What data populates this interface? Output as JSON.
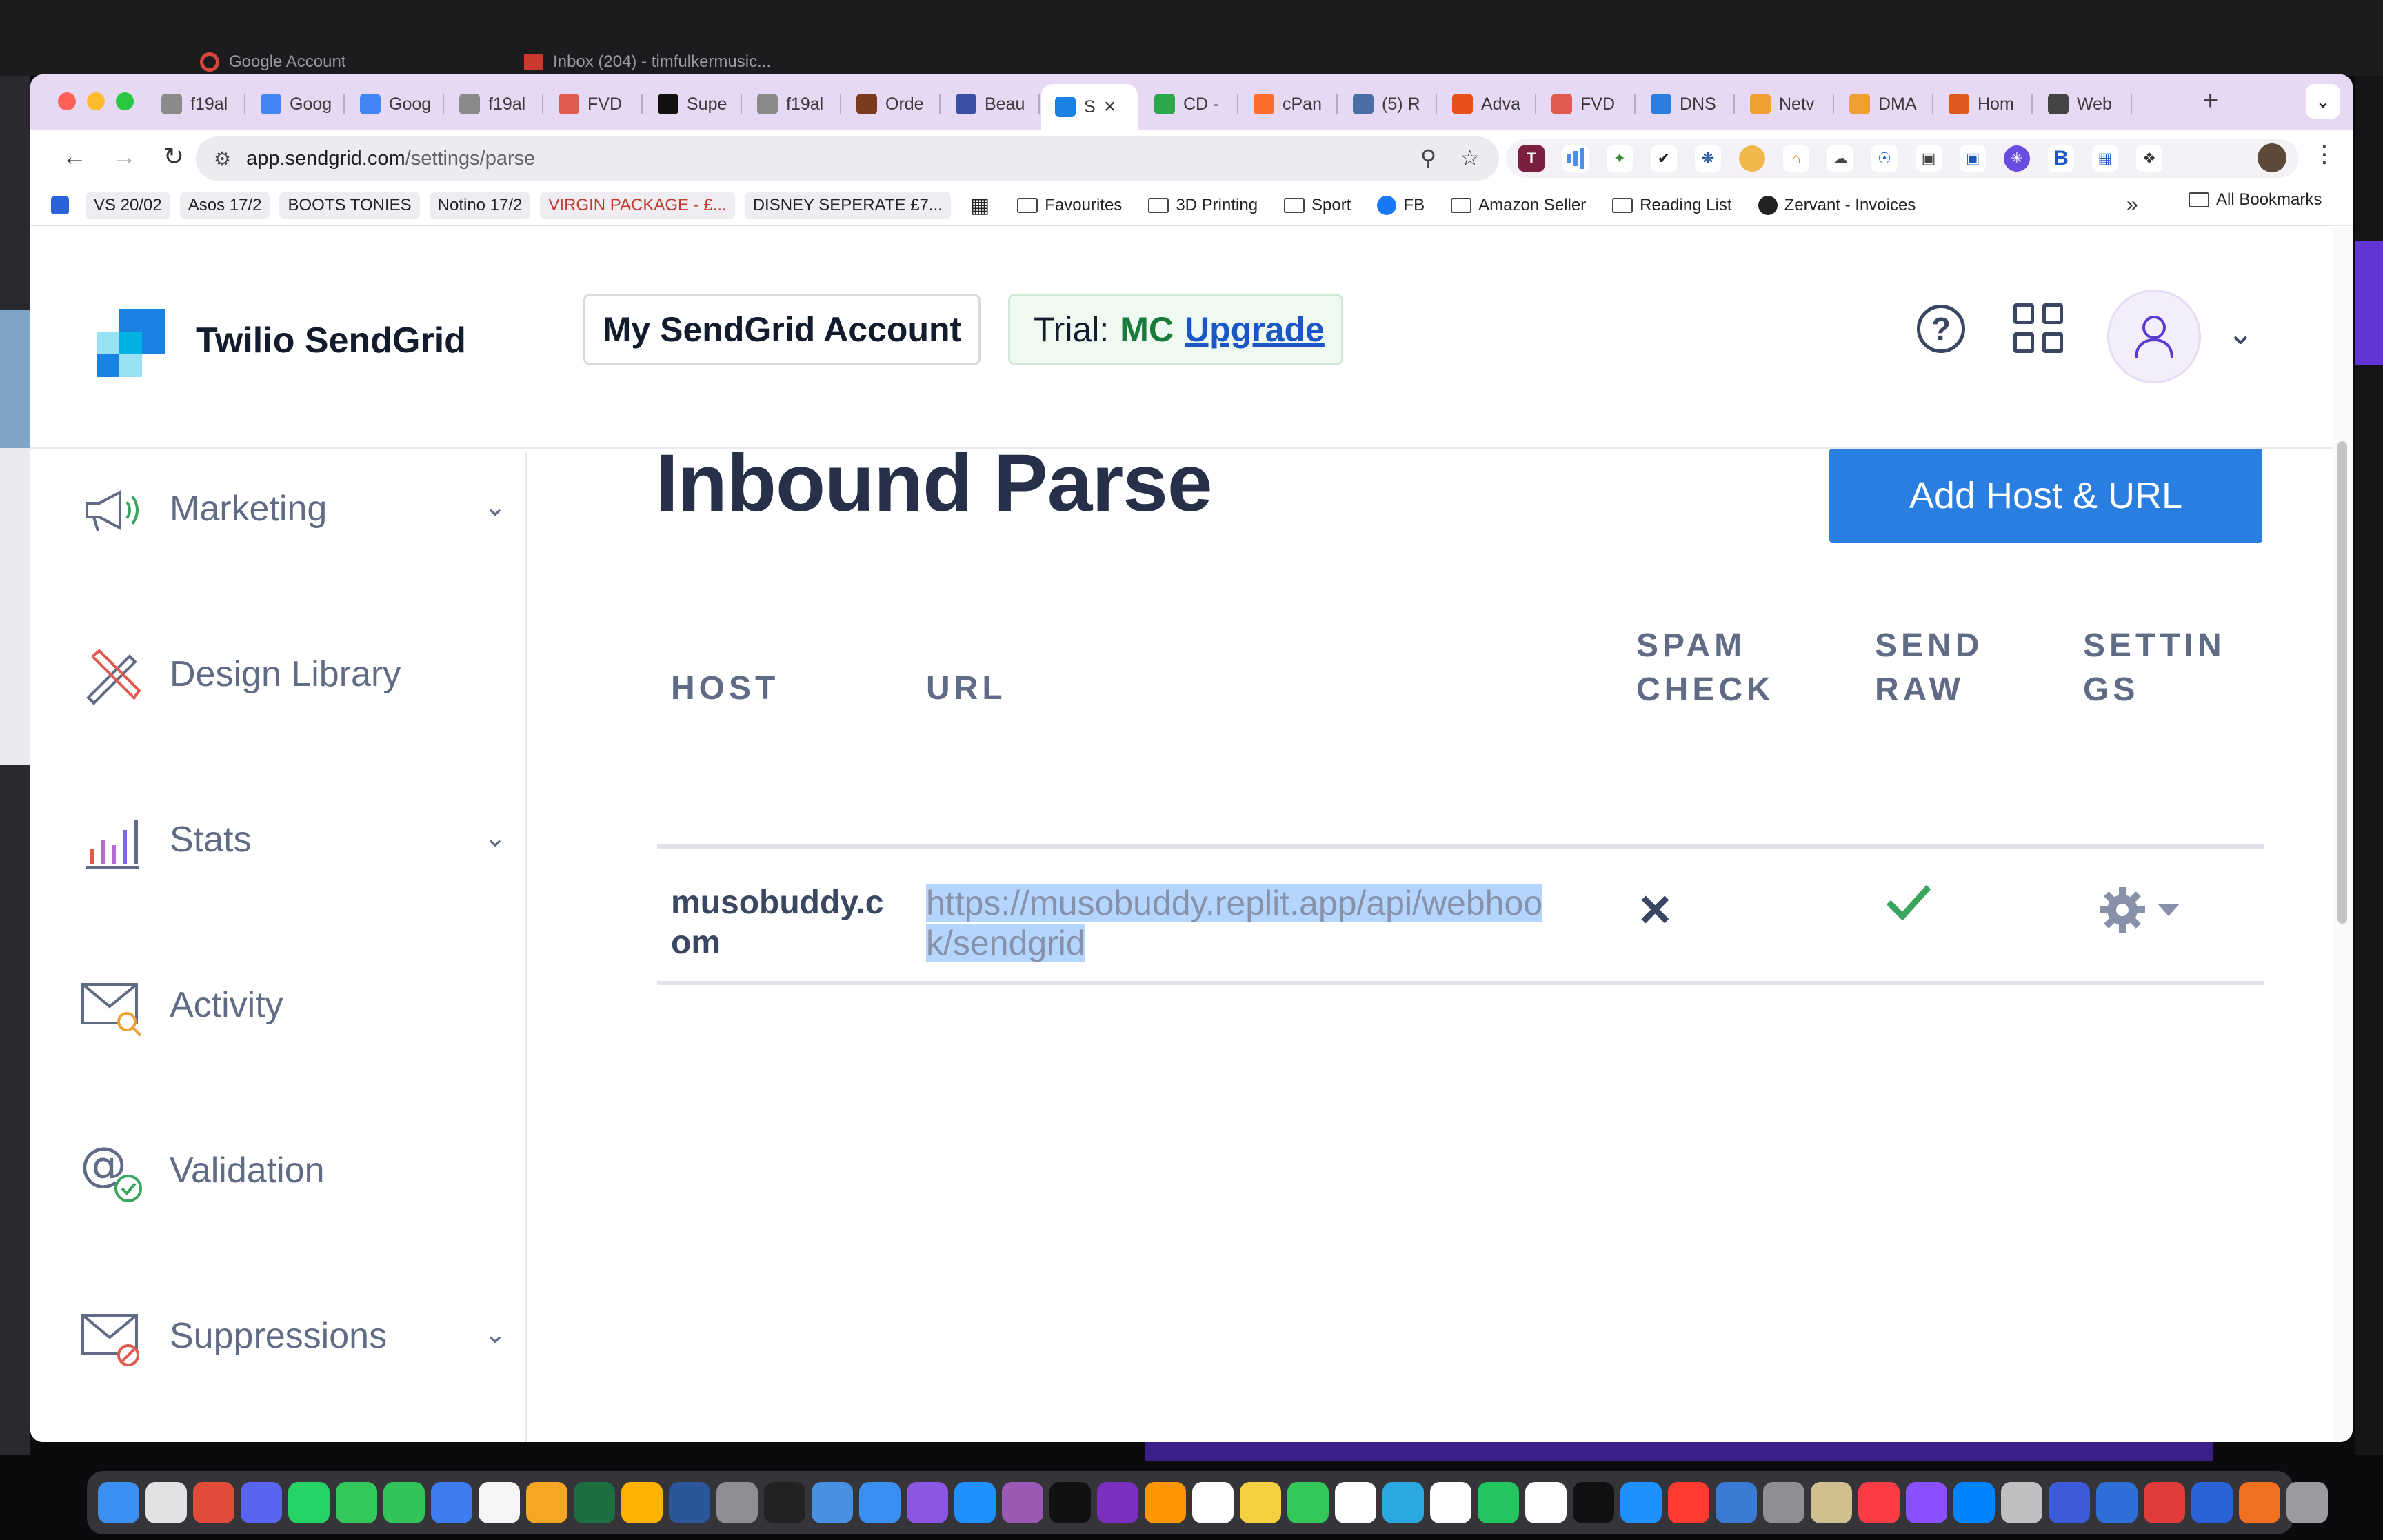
{
  "background": {
    "tabs": [
      {
        "label": "Google Account"
      },
      {
        "label": "Inbox (204) - timfulkermusic..."
      }
    ]
  },
  "browser": {
    "tabs": [
      {
        "label": "f19al",
        "icon": "grey-circle-icon"
      },
      {
        "label": "Goog",
        "icon": "google-calendar-icon"
      },
      {
        "label": "Goog",
        "icon": "google-calendar-icon"
      },
      {
        "label": "f19al",
        "icon": "grey-circle-icon"
      },
      {
        "label": "FVD",
        "icon": "house-icon"
      },
      {
        "label": "Supe",
        "icon": "black-square-icon"
      },
      {
        "label": "f19al",
        "icon": "grey-circle-icon"
      },
      {
        "label": "Orde",
        "icon": "tv-icon"
      },
      {
        "label": "Beau",
        "icon": "scissors-icon"
      },
      {
        "label": "S",
        "icon": "sendgrid-icon",
        "active": true
      },
      {
        "label": "CD -",
        "icon": "cd-icon"
      },
      {
        "label": "cPan",
        "icon": "cpanel-icon"
      },
      {
        "label": "(5) R",
        "icon": "reddit-icon"
      },
      {
        "label": "Adva",
        "icon": "orange-square-icon"
      },
      {
        "label": "FVD",
        "icon": "house-icon"
      },
      {
        "label": "DNS",
        "icon": "shield-icon"
      },
      {
        "label": "Netv",
        "icon": "x-orange-icon"
      },
      {
        "label": "DMA",
        "icon": "x-orange-icon"
      },
      {
        "label": "Hom",
        "icon": "orange-puzzle-icon"
      },
      {
        "label": "Web",
        "icon": "robot-icon"
      }
    ],
    "address": {
      "host": "app.sendgrid.com",
      "path": "/settings/parse"
    },
    "bookmarks": [
      {
        "label": "VS 20/02",
        "chip": true
      },
      {
        "label": "Asos 17/2",
        "chip": true
      },
      {
        "label": "BOOTS TONIES",
        "chip": true
      },
      {
        "label": "Notino 17/2",
        "chip": true
      },
      {
        "label": "VIRGIN PACKAGE - £...",
        "chip": true,
        "red": true
      },
      {
        "label": "DISNEY SEPERATE £7...",
        "chip": true
      }
    ],
    "bookmark_folders": [
      {
        "label": "Favourites",
        "icon": "folder-icon"
      },
      {
        "label": "3D Printing",
        "icon": "folder-icon"
      },
      {
        "label": "Sport",
        "icon": "folder-icon"
      },
      {
        "label": "FB",
        "icon": "facebook-icon"
      },
      {
        "label": "Amazon Seller",
        "icon": "folder-icon"
      },
      {
        "label": "Reading List",
        "icon": "folder-icon"
      },
      {
        "label": "Zervant - Invoices",
        "icon": "zervant-icon"
      }
    ],
    "bookmarks_more": "»",
    "all_bookmarks": "All Bookmarks"
  },
  "header": {
    "brand": "Twilio SendGrid",
    "account_button": "My SendGrid Account",
    "trial_label": "Trial:",
    "trial_code": "MC",
    "upgrade": "Upgrade"
  },
  "sidebar": {
    "items": [
      {
        "label": "Marketing",
        "icon": "megaphone-icon",
        "caret": true
      },
      {
        "label": "Design Library",
        "icon": "design-tools-icon",
        "caret": false
      },
      {
        "label": "Stats",
        "icon": "bar-chart-icon",
        "caret": true
      },
      {
        "label": "Activity",
        "icon": "envelope-search-icon",
        "caret": false
      },
      {
        "label": "Validation",
        "icon": "at-check-icon",
        "caret": false
      },
      {
        "label": "Suppressions",
        "icon": "envelope-blocked-icon",
        "caret": true
      }
    ]
  },
  "main": {
    "title": "Inbound Parse",
    "add_button": "Add Host & URL",
    "table": {
      "headers": {
        "host": "HOST",
        "url": "URL",
        "spam_check_1": "SPAM",
        "spam_check_2": "CHECK",
        "send_raw_1": "SEND",
        "send_raw_2": "RAW",
        "settings_1": "SETTIN",
        "settings_2": "GS"
      },
      "rows": [
        {
          "host_1": "musobuddy.c",
          "host_2": "om",
          "url_1": "https://musobuddy.replit.app/api/webhoo",
          "url_2": "k/sendgrid",
          "spam_check": "×",
          "send_raw": "checked"
        }
      ]
    }
  },
  "colors": {
    "primary_button": "#2a7ee0",
    "heading": "#263149",
    "trial_green": "#1a7a3a",
    "upgrade_blue": "#1a56c4",
    "check_green": "#3aa55c",
    "selection": "#b4d5fe",
    "tabstrip": "#e7d9f3"
  }
}
